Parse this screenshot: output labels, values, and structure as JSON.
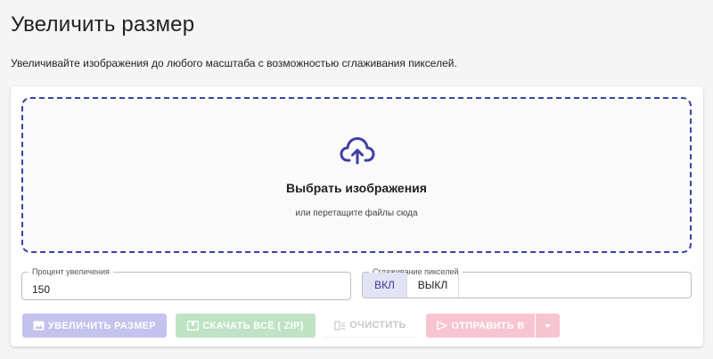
{
  "header": {
    "title": "Увеличить размер",
    "subtitle": "Увеличивайте изображения до любого масштаба с возможностью сглаживания пикселей."
  },
  "dropzone": {
    "icon": "cloud-upload-icon",
    "title": "Выбрать изображения",
    "hint": "или перетащите файлы сюда"
  },
  "scale": {
    "label": "Процент увеличения",
    "value": "150"
  },
  "smoothing": {
    "label": "Сглаживание пикселей",
    "on_label": "ВКЛ",
    "off_label": "ВЫКЛ",
    "selected": "ВКЛ"
  },
  "actions": {
    "upscale_label": "УВЕЛИЧИТЬ РАЗМЕР",
    "download_label": "СКАЧАТЬ ВСЁ ( ZIP)",
    "clear_label": "ОЧИСТИТЬ",
    "send_label": "ОТПРАВИТЬ В"
  },
  "colors": {
    "accent": "#3f3fa8",
    "upscale_disabled": "#c3c3ee",
    "download_disabled": "#bfe3c4",
    "send_disabled": "#f7c5d0"
  }
}
